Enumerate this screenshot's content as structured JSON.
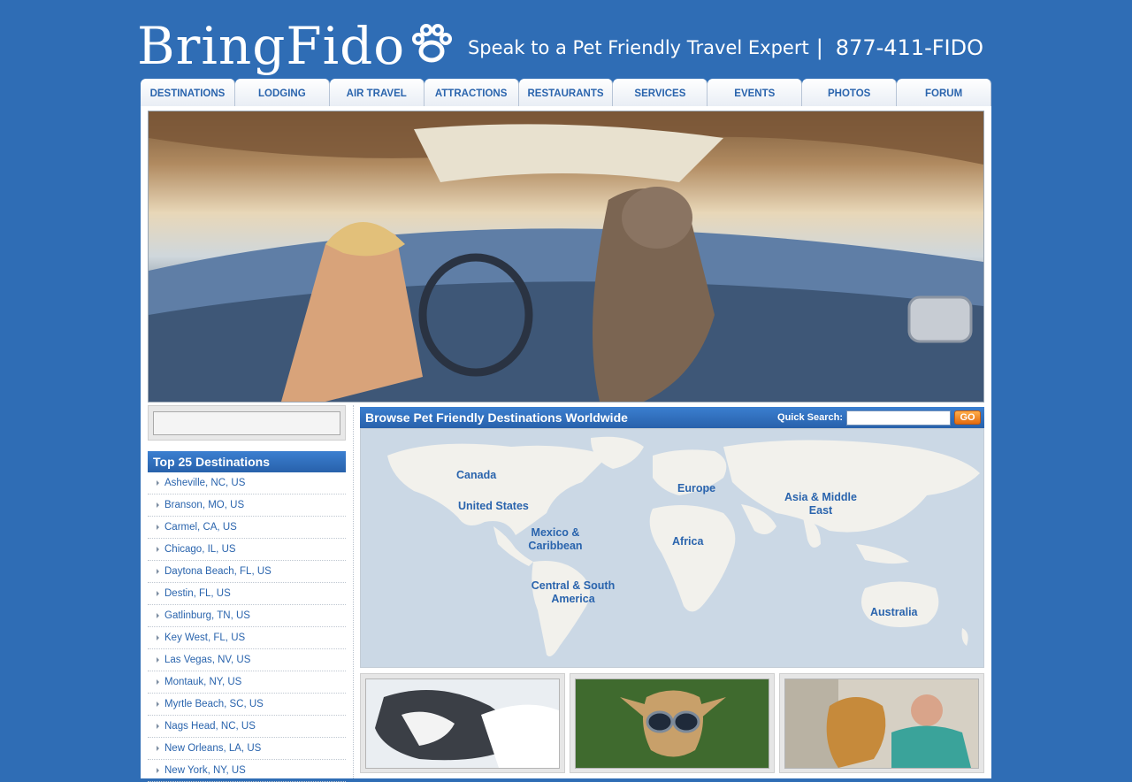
{
  "header": {
    "logo_text": "BringFido",
    "tagline": "Speak to a Pet Friendly Travel Expert",
    "separator": "|",
    "phone": "877-411-FIDO"
  },
  "nav": {
    "tabs": [
      "DESTINATIONS",
      "LODGING",
      "AIR TRAVEL",
      "ATTRACTIONS",
      "RESTAURANTS",
      "SERVICES",
      "EVENTS",
      "PHOTOS",
      "FORUM"
    ]
  },
  "top25": {
    "title": "Top 25 Destinations",
    "items": [
      "Asheville, NC, US",
      "Branson, MO, US",
      "Carmel, CA, US",
      "Chicago, IL, US",
      "Daytona Beach, FL, US",
      "Destin, FL, US",
      "Gatlinburg, TN, US",
      "Key West, FL, US",
      "Las Vegas, NV, US",
      "Montauk, NY, US",
      "Myrtle Beach, SC, US",
      "Nags Head, NC, US",
      "New Orleans, LA, US",
      "New York, NY, US"
    ]
  },
  "browse": {
    "title": "Browse Pet Friendly Destinations Worldwide",
    "quick_search_label": "Quick Search:",
    "go_label": "GO",
    "regions": {
      "canada": "Canada",
      "united_states": "United States",
      "mexico": "Mexico & Caribbean",
      "central_south": "Central & South America",
      "europe": "Europe",
      "africa": "Africa",
      "asia": "Asia & Middle East",
      "australia": "Australia"
    }
  },
  "colors": {
    "background": "#2f6db5",
    "link": "#2a64ad",
    "header_bar": "#2861ab",
    "go_button": "#e46b10"
  }
}
